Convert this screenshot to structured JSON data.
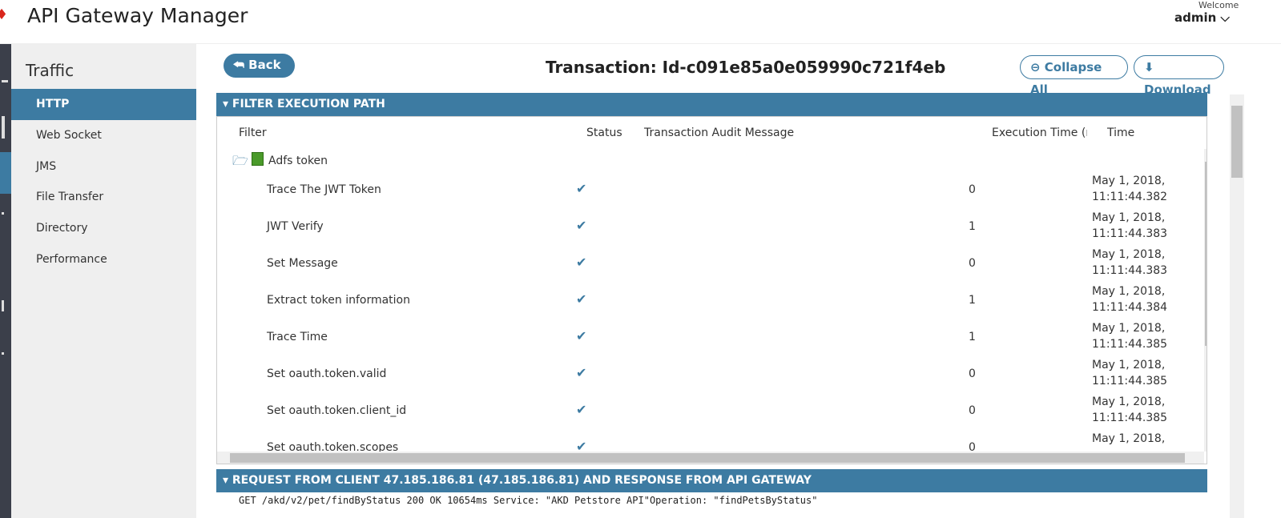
{
  "header": {
    "title": "API Gateway Manager",
    "welcome": "Welcome",
    "user": "admin ⌵"
  },
  "sidebar": {
    "title": "Traffic",
    "items": [
      {
        "label": "HTTP",
        "active": true
      },
      {
        "label": "Web Socket"
      },
      {
        "label": "JMS"
      },
      {
        "label": "File Transfer"
      },
      {
        "label": "Directory"
      },
      {
        "label": "Performance"
      }
    ]
  },
  "toolbar": {
    "back": "⮪ Back",
    "title": "Transaction: Id-c091e85a0e059990c721f4eb",
    "collapse": "⊖ Collapse All",
    "download": "⬇ Download"
  },
  "filter_panel": {
    "header": "▾ FILTER EXECUTION PATH",
    "columns": [
      "Filter",
      "Status",
      "Transaction Audit Message",
      "Execution Time (m",
      "Time"
    ],
    "group": "Adfs token",
    "rows": [
      {
        "filter": "Trace The JWT Token",
        "status": "✔",
        "exec": "0",
        "date": "May 1, 2018,",
        "time": "11:11:44.382"
      },
      {
        "filter": "JWT Verify",
        "status": "✔",
        "exec": "1",
        "date": "May 1, 2018,",
        "time": "11:11:44.383"
      },
      {
        "filter": "Set Message",
        "status": "✔",
        "exec": "0",
        "date": "May 1, 2018,",
        "time": "11:11:44.383"
      },
      {
        "filter": "Extract token information",
        "status": "✔",
        "exec": "1",
        "date": "May 1, 2018,",
        "time": "11:11:44.384"
      },
      {
        "filter": "Trace Time",
        "status": "✔",
        "exec": "1",
        "date": "May 1, 2018,",
        "time": "11:11:44.385"
      },
      {
        "filter": "Set oauth.token.valid",
        "status": "✔",
        "exec": "0",
        "date": "May 1, 2018,",
        "time": "11:11:44.385"
      },
      {
        "filter": "Set oauth.token.client_id",
        "status": "✔",
        "exec": "0",
        "date": "May 1, 2018,",
        "time": "11:11:44.385"
      },
      {
        "filter": "Set oauth.token.scopes",
        "status": "✔",
        "exec": "0",
        "date": "May 1, 2018,",
        "time": ""
      }
    ]
  },
  "request_panel": {
    "header": "▾ REQUEST FROM CLIENT 47.185.186.81 (47.185.186.81) AND RESPONSE FROM API GATEWAY",
    "line": "GET /akd/v2/pet/findByStatus 200 OK 10654ms Service: \"AKD Petstore API\"Operation: \"findPetsByStatus\""
  },
  "colors": {
    "accent": "#3d7ba2",
    "nav": "#3b3f4a"
  }
}
